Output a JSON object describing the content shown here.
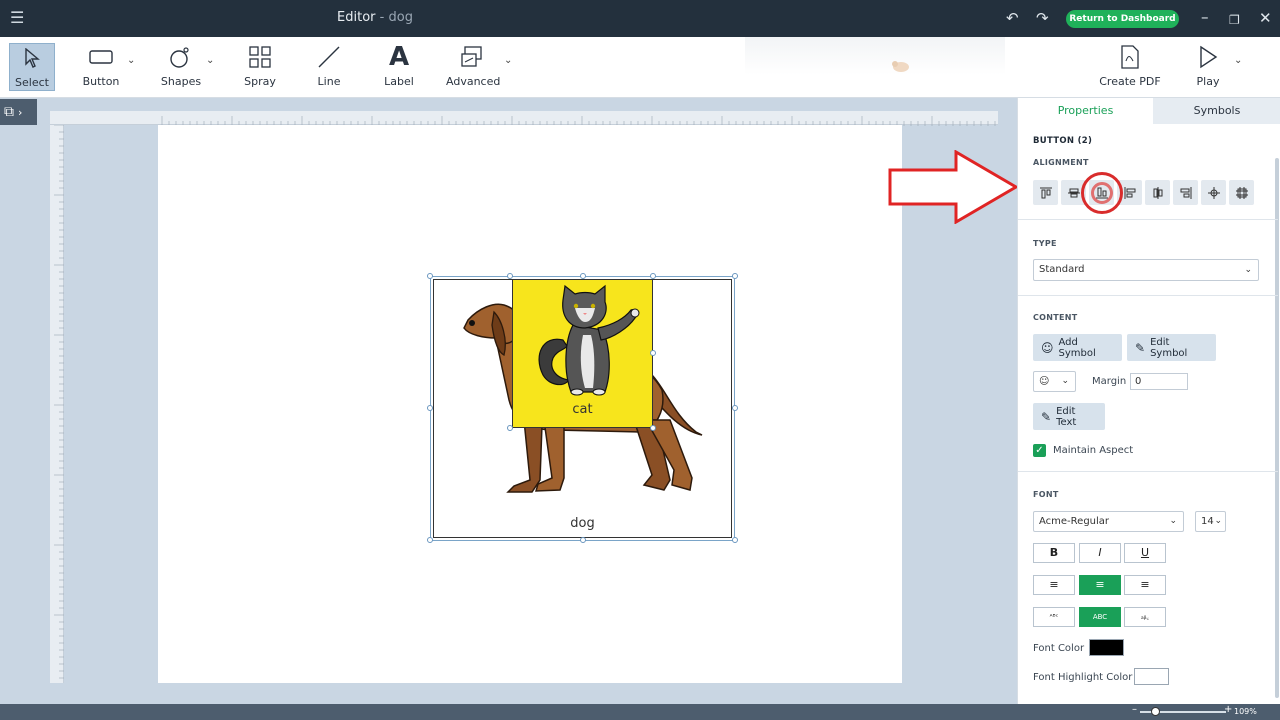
{
  "titlebar": {
    "title": "Editor",
    "doc_name": " - dog",
    "return_label": "Return to Dashboard",
    "menu_icon": "hamburger-icon"
  },
  "toolbar": {
    "tools": [
      {
        "label": "Select",
        "icon": "cursor-icon",
        "active": true
      },
      {
        "label": "Button",
        "icon": "rectangle-icon"
      },
      {
        "label": "Shapes",
        "icon": "shapes-icon"
      },
      {
        "label": "Spray",
        "icon": "grid-icon"
      },
      {
        "label": "Line",
        "icon": "line-icon"
      },
      {
        "label": "Label",
        "icon": "text-a-icon"
      },
      {
        "label": "Advanced",
        "icon": "advanced-icon"
      }
    ],
    "right": [
      {
        "label": "Create PDF",
        "icon": "pdf-icon"
      },
      {
        "label": "Play",
        "icon": "play-icon"
      }
    ]
  },
  "canvas": {
    "dog_label": "dog",
    "cat_label": "cat"
  },
  "panel": {
    "tabs": {
      "properties": "Properties",
      "symbols": "Symbols"
    },
    "selection": "BUTTON (2)",
    "alignment_heading": "ALIGNMENT",
    "type_heading": "TYPE",
    "type_value": "Standard",
    "content_heading": "CONTENT",
    "add_symbol": "Add Symbol",
    "edit_symbol": "Edit Symbol",
    "margin_label": "Margin",
    "margin_value": "0",
    "edit_text": "Edit Text",
    "maintain_aspect": "Maintain Aspect",
    "font_heading": "FONT",
    "font_family": "Acme-Regular",
    "font_size": "14",
    "bold": "B",
    "italic": "I",
    "underline": "U",
    "font_color_label": "Font Color",
    "font_color": "#000000",
    "font_highlight_label": "Font Highlight Color",
    "font_highlight": "#ffffff",
    "accent": "#1aa058"
  },
  "status": {
    "zoom": "109%"
  }
}
